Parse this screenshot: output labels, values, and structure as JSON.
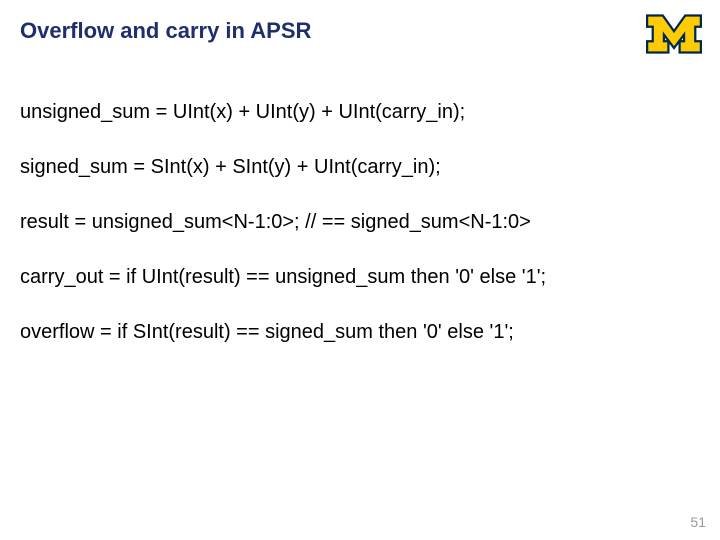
{
  "title": "Overflow and carry in APSR",
  "lines": [
    "unsigned_sum = UInt(x) + UInt(y) + UInt(carry_in);",
    "signed_sum = SInt(x) + SInt(y) + UInt(carry_in);",
    "result = unsigned_sum<N-1:0>; // == signed_sum<N-1:0>",
    "carry_out = if UInt(result) == unsigned_sum then '0' else '1';",
    "overflow = if SInt(result) == signed_sum then '0' else '1';"
  ],
  "page_number": "51",
  "logo": {
    "semantic": "university-of-michigan-block-m",
    "fill": "#ffcb05",
    "outline": "#00274c"
  }
}
